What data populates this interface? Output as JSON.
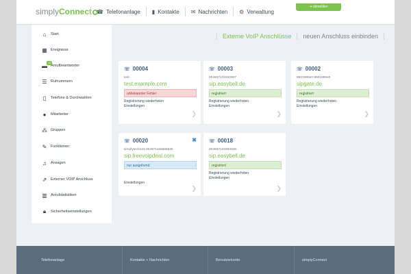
{
  "header": {
    "logo_left": "simply",
    "logo_right": "Connect",
    "nav": [
      {
        "label": "Telefonanlage",
        "icon": "phone-icon"
      },
      {
        "label": "Kontakte",
        "icon": "book-icon"
      },
      {
        "label": "Nachrichten",
        "icon": "envelope-icon"
      },
      {
        "label": "Verwaltung",
        "icon": "gears-icon"
      }
    ],
    "logout_label": "abmelden"
  },
  "sidebar": {
    "items": [
      {
        "label": "Start",
        "icon": "home-icon"
      },
      {
        "label": "Ereignisse",
        "icon": "calendar-icon"
      },
      {
        "label": "Anrufbeantworter",
        "icon": "voicemail-icon",
        "badge": "12"
      },
      {
        "label": "Rufnummern",
        "icon": "list-icon"
      },
      {
        "label": "Telefone & Durchwahlen",
        "icon": "mobile-icon"
      },
      {
        "label": "Mitarbeiter",
        "icon": "user-icon"
      },
      {
        "label": "Gruppen",
        "icon": "group-icon"
      },
      {
        "label": "Funktionen",
        "icon": "wand-icon"
      },
      {
        "label": "Ansagen",
        "icon": "music-icon"
      },
      {
        "label": "Externer VOIP Anschluss",
        "icon": "external-link-icon"
      },
      {
        "label": "Anrufstatistiken",
        "icon": "bar-chart-icon"
      },
      {
        "label": "Sicherheitseinstellungen",
        "icon": "lock-icon"
      }
    ]
  },
  "tabs": {
    "active": "Externe VoIP Anschlüsse",
    "other": "neuen Anschluss einbinden"
  },
  "cards": [
    {
      "id": "00004",
      "desc": "test",
      "host": "test.example.com",
      "status": "unbekannter Fehler",
      "status_color": "red",
      "link1": "Registrierung wiederholen",
      "link2": "Einstellungen"
    },
    {
      "id": "00003",
      "desc": "004937133222907",
      "host": "sip.easybell.de",
      "status": "registriert",
      "status_color": "green",
      "link1": "Registrierung wiederholen",
      "link2": "Einstellungen"
    },
    {
      "id": "00002",
      "desc": "8601986e0 8601986e0",
      "host": "sipgate.de",
      "status": "registriert",
      "status_color": "green",
      "link1": "Registrierung wiederholen",
      "link2": "Einstellungen"
    },
    {
      "id": "00020",
      "desc": "simplytech123 004971166866835",
      "host": "sip.freevoipdeal.com",
      "status": "nur ausgehend",
      "status_color": "blue",
      "link1": "",
      "link2": "Einstellungen"
    },
    {
      "id": "00018",
      "desc": "004937133350046",
      "host": "sip.easybell.de",
      "status": "registriert",
      "status_color": "green",
      "link1": "Registrierung wiederholen",
      "link2": "Einstellungen"
    }
  ],
  "footer": {
    "cols": [
      "Telefonanlage",
      "Kontakte + Nachrichten",
      "Benutzerkonto",
      "simplyConnect"
    ]
  },
  "colors": {
    "accent": "#7cc24e",
    "title_blue": "#3b5a7a",
    "footer_bg": "#5b6c7c"
  }
}
